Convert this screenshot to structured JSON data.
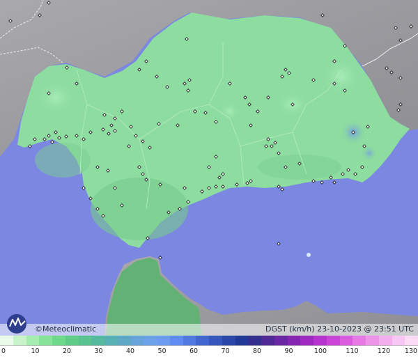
{
  "map": {
    "brand": "©Meteoclimatic",
    "product": "DGST (km/h)   23-10-2023 @ 23:51 UTC"
  },
  "legend": {
    "colors": [
      "#e9fbe9",
      "#c9f4c9",
      "#a7ecb0",
      "#86e39a",
      "#6ed98a",
      "#5fcd86",
      "#58c390",
      "#55b99e",
      "#57b0b3",
      "#5ea8c6",
      "#66a4d9",
      "#6ba2ea",
      "#6b9cf2",
      "#5e8cf0",
      "#4f79e0",
      "#4266cf",
      "#3554bc",
      "#2a46a8",
      "#223a97",
      "#342f8e",
      "#4f2a96",
      "#6a27a3",
      "#8526b3",
      "#9f2ac2",
      "#b733cf",
      "#cb44d8",
      "#db5ddf",
      "#e679e3",
      "#ee94e8",
      "#f3aeed",
      "#f7c6f2",
      "#fadcf7"
    ],
    "ticks": [
      "0",
      "10",
      "20",
      "30",
      "40",
      "50",
      "60",
      "70",
      "80",
      "90",
      "100",
      "110",
      "120",
      "130"
    ]
  }
}
